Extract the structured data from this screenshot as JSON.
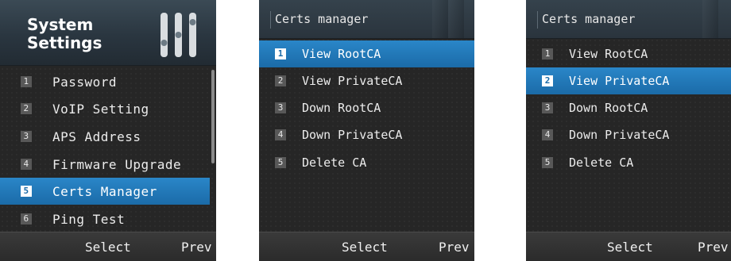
{
  "screen1": {
    "title_line1": "System",
    "title_line2": "Settings",
    "items": [
      {
        "num": "1",
        "label": "Password"
      },
      {
        "num": "2",
        "label": "VoIP Setting"
      },
      {
        "num": "3",
        "label": "APS Address"
      },
      {
        "num": "4",
        "label": "Firmware Upgrade"
      },
      {
        "num": "5",
        "label": "Certs Manager"
      },
      {
        "num": "6",
        "label": "Ping Test"
      }
    ],
    "selected_index": 4,
    "softkey_left": "Select",
    "softkey_right": "Prev"
  },
  "screen2": {
    "title": "Certs manager",
    "items": [
      {
        "num": "1",
        "label": "View RootCA"
      },
      {
        "num": "2",
        "label": "View PrivateCA"
      },
      {
        "num": "3",
        "label": "Down RootCA"
      },
      {
        "num": "4",
        "label": "Down PrivateCA"
      },
      {
        "num": "5",
        "label": "Delete CA"
      }
    ],
    "selected_index": 0,
    "softkey_left": "Select",
    "softkey_right": "Prev"
  },
  "screen3": {
    "title": "Certs manager",
    "items": [
      {
        "num": "1",
        "label": "View RootCA"
      },
      {
        "num": "2",
        "label": "View PrivateCA"
      },
      {
        "num": "3",
        "label": "Down RootCA"
      },
      {
        "num": "4",
        "label": "Down PrivateCA"
      },
      {
        "num": "5",
        "label": "Delete CA"
      }
    ],
    "selected_index": 1,
    "softkey_left": "Select",
    "softkey_right": "Prev"
  },
  "colors": {
    "highlight": "#1b6ba8",
    "screen_bg": "#262626",
    "header_bg": "#2a3640"
  }
}
